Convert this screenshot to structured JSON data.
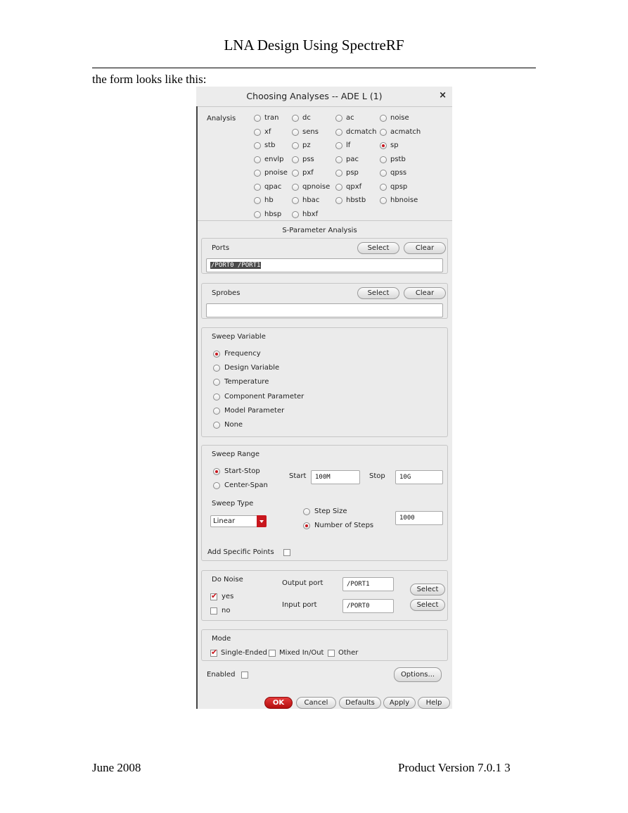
{
  "document": {
    "header_title": "LNA Design Using SpectreRF",
    "caption": "the form looks like this:",
    "footer_left": "June 2008",
    "footer_right": "Product Version 7.0.1 3"
  },
  "dialog": {
    "title": "Choosing Analyses -- ADE L (1)",
    "close_icon": "close-icon",
    "analysis_label": "Analysis",
    "analyses": [
      [
        "tran",
        "dc",
        "ac",
        "noise"
      ],
      [
        "xf",
        "sens",
        "dcmatch",
        "acmatch"
      ],
      [
        "stb",
        "pz",
        "lf",
        "sp"
      ],
      [
        "envlp",
        "pss",
        "pac",
        "pstb"
      ],
      [
        "pnoise",
        "pxf",
        "psp",
        "qpss"
      ],
      [
        "qpac",
        "qpnoise",
        "qpxf",
        "qpsp"
      ],
      [
        "hb",
        "hbac",
        "hbstb",
        "hbnoise"
      ],
      [
        "hbsp",
        "hbxf"
      ]
    ],
    "selected_analysis": "sp",
    "section_title": "S-Parameter Analysis",
    "ports": {
      "label": "Ports",
      "select": "Select",
      "clear": "Clear",
      "value": "/PORT0 /PORT1"
    },
    "sprobes": {
      "label": "Sprobes",
      "select": "Select",
      "clear": "Clear",
      "value": ""
    },
    "sweep_variable": {
      "label": "Sweep Variable",
      "options": [
        "Frequency",
        "Design Variable",
        "Temperature",
        "Component Parameter",
        "Model Parameter",
        "None"
      ],
      "selected": "Frequency"
    },
    "sweep_range": {
      "label": "Sweep Range",
      "options": [
        "Start-Stop",
        "Center-Span"
      ],
      "selected": "Start-Stop",
      "start_label": "Start",
      "start_value": "100M",
      "stop_label": "Stop",
      "stop_value": "10G",
      "sweep_type_label": "Sweep Type",
      "sweep_type_value": "Linear",
      "step_options": [
        "Step Size",
        "Number of Steps"
      ],
      "step_selected": "Number of Steps",
      "steps_value": "1000",
      "add_points_label": "Add Specific Points",
      "add_points_checked": false
    },
    "do_noise": {
      "label": "Do Noise",
      "yes": "yes",
      "yes_checked": true,
      "no": "no",
      "no_checked": false,
      "output_port_label": "Output port",
      "output_port_value": "/PORT1",
      "input_port_label": "Input port",
      "input_port_value": "/PORT0",
      "select": "Select"
    },
    "mode": {
      "label": "Mode",
      "options": [
        "Single-Ended",
        "Mixed In/Out",
        "Other"
      ],
      "checked": [
        true,
        false,
        false
      ]
    },
    "enabled_label": "Enabled",
    "enabled_checked": false,
    "options_button": "Options...",
    "buttons": {
      "ok": "OK",
      "cancel": "Cancel",
      "defaults": "Defaults",
      "apply": "Apply",
      "help": "Help"
    },
    "colors": {
      "accent": "#c8161d",
      "panel": "#ececec"
    }
  }
}
